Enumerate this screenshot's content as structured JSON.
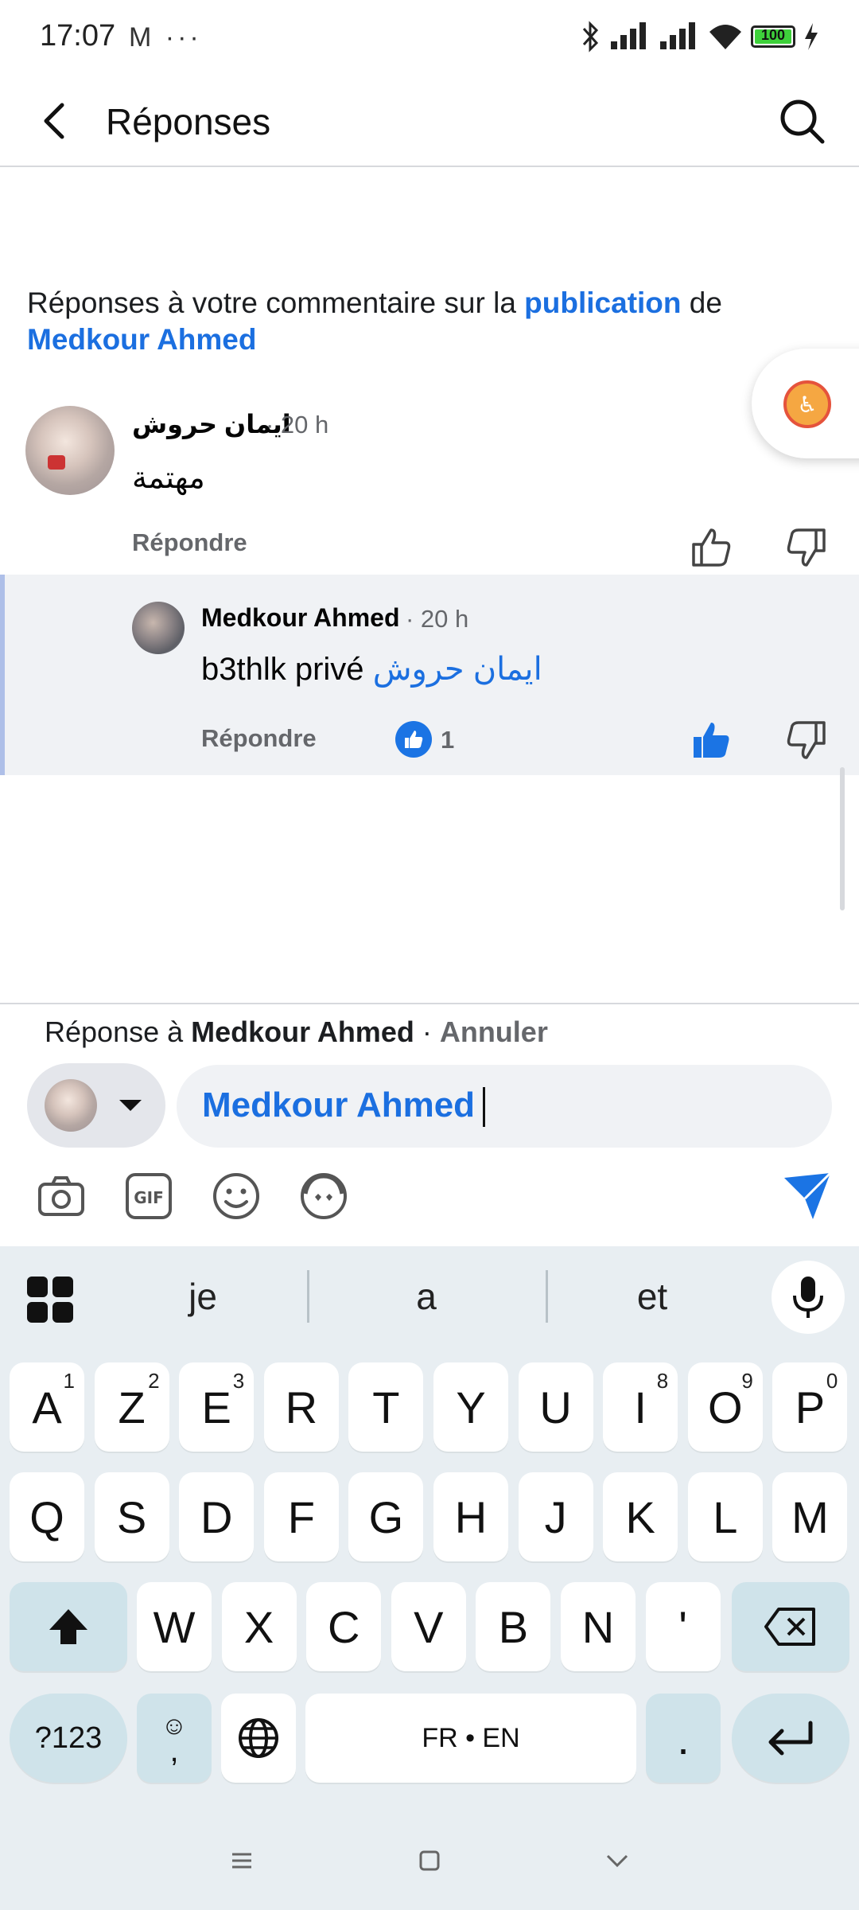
{
  "status_bar": {
    "time": "17:07",
    "left_icons": "M ···",
    "battery": "100"
  },
  "header": {
    "title": "Réponses"
  },
  "context": {
    "prefix": "Réponses à votre commentaire sur la ",
    "link": "publication",
    "middle": " de",
    "author": "Medkour Ahmed"
  },
  "comments": [
    {
      "author": "ايمان حروش",
      "time": "· 20 h",
      "text": "مهتمة",
      "reply_label": "Répondre"
    },
    {
      "author": "Medkour Ahmed",
      "time": "· 20 h",
      "text": "b3thlk privé",
      "mention": "ايمان حروش",
      "reply_label": "Répondre",
      "reaction_count": "1"
    }
  ],
  "composer": {
    "reply_prefix": "Réponse à ",
    "reply_target": "Medkour Ahmed",
    "reply_sep": " · ",
    "cancel_label": "Annuler",
    "input_value": "Medkour Ahmed"
  },
  "keyboard": {
    "suggestions": [
      "je",
      "a",
      "et"
    ],
    "row1": [
      {
        "k": "A",
        "s": "1"
      },
      {
        "k": "Z",
        "s": "2"
      },
      {
        "k": "E",
        "s": "3"
      },
      {
        "k": "R",
        "s": ""
      },
      {
        "k": "T",
        "s": ""
      },
      {
        "k": "Y",
        "s": ""
      },
      {
        "k": "U",
        "s": ""
      },
      {
        "k": "I",
        "s": "8"
      },
      {
        "k": "O",
        "s": "9"
      },
      {
        "k": "P",
        "s": "0"
      }
    ],
    "row2": [
      "Q",
      "S",
      "D",
      "F",
      "G",
      "H",
      "J",
      "K",
      "L",
      "M"
    ],
    "row3": [
      "W",
      "X",
      "C",
      "V",
      "B",
      "N",
      "'"
    ],
    "symbols_label": "?123",
    "emoji_comma": ",",
    "space_label": "FR • EN",
    "period": "."
  },
  "colors": {
    "accent": "#1b6fe0",
    "secondary_text": "#65676b",
    "keyboard_bg": "#e8eef2",
    "special_key": "#cfe3ea"
  }
}
